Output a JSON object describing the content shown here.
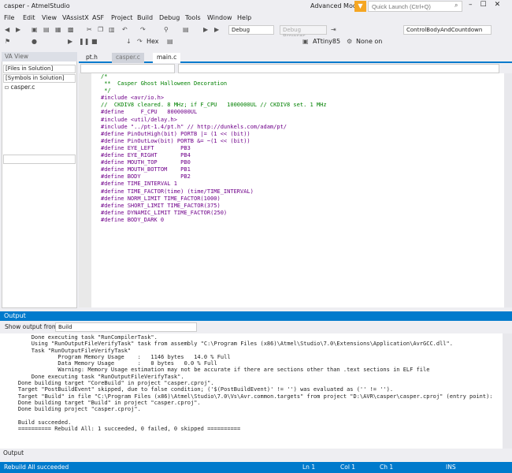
{
  "window": {
    "title": "casper - AtmelStudio",
    "mode": "Advanced Mode",
    "quick_launch": "Quick Launch (Ctrl+Q)"
  },
  "menu": [
    "File",
    "Edit",
    "View",
    "VAssistX",
    "ASF",
    "Project",
    "Build",
    "Debug",
    "Tools",
    "Window",
    "Help"
  ],
  "toolbar": {
    "config": "Debug",
    "platform": "Debug Browser",
    "target": "ControlBodyAndCountdown",
    "device": "ATtiny85",
    "tool": "None on",
    "hex": "Hex"
  },
  "va_view": {
    "title": "VA View",
    "filter1": "[Files in Solution]",
    "filter2": "[Symbols in Solution]",
    "item": "casper.c"
  },
  "tabs": [
    "pt.h",
    "casper.c",
    "main.c"
  ],
  "code": [
    {
      "t": "c",
      "v": "/*"
    },
    {
      "t": "c",
      "v": " **  Casper Ghost Halloween Decoration"
    },
    {
      "t": "c",
      "v": " */"
    },
    {
      "t": "n",
      "v": ""
    },
    {
      "t": "d",
      "v": "#include <avr/io.h>"
    },
    {
      "t": "c",
      "v": "//  CKDIV8 cleared. 8 MHz; if F_CPU   1000000UL // CKDIV8 set. 1 MHz"
    },
    {
      "t": "d",
      "v": "#define     F_CPU   8000000UL"
    },
    {
      "t": "d",
      "v": "#include <util/delay.h>"
    },
    {
      "t": "d",
      "v": "#include \"../pt-1.4/pt.h\" // http://dunkels.com/adam/pt/"
    },
    {
      "t": "n",
      "v": ""
    },
    {
      "t": "d",
      "v": "#define PinOutHigh(bit) PORTB |= (1 << (bit))"
    },
    {
      "t": "n",
      "v": ""
    },
    {
      "t": "d",
      "v": "#define PinOutLow(bit) PORTB &= ~(1 << (bit))"
    },
    {
      "t": "n",
      "v": ""
    },
    {
      "t": "d",
      "v": "#define EYE_LEFT        PB3"
    },
    {
      "t": "d",
      "v": "#define EYE_RIGHT       PB4"
    },
    {
      "t": "n",
      "v": ""
    },
    {
      "t": "d",
      "v": "#define MOUTH_TOP       PB0"
    },
    {
      "t": "d",
      "v": "#define MOUTH_BOTTOM    PB1"
    },
    {
      "t": "d",
      "v": "#define BODY            PB2"
    },
    {
      "t": "n",
      "v": ""
    },
    {
      "t": "d",
      "v": "#define TIME_INTERVAL 1"
    },
    {
      "t": "n",
      "v": ""
    },
    {
      "t": "d",
      "v": "#define TIME_FACTOR(time) (time/TIME_INTERVAL)"
    },
    {
      "t": "n",
      "v": ""
    },
    {
      "t": "d",
      "v": "#define NORM_LIMIT TIME_FACTOR(1000)"
    },
    {
      "t": "n",
      "v": ""
    },
    {
      "t": "d",
      "v": "#define SHORT_LIMIT TIME_FACTOR(375)"
    },
    {
      "t": "n",
      "v": ""
    },
    {
      "t": "d",
      "v": "#define DYNAMIC_LIMIT TIME_FACTOR(250)"
    },
    {
      "t": "n",
      "v": ""
    },
    {
      "t": "d",
      "v": "#define BODY_DARK 0"
    }
  ],
  "output": {
    "title": "Output",
    "show_from_label": "Show output from:",
    "source": "Build",
    "lines": [
      "        Done executing task \"RunCompilerTask\".",
      "        Using \"RunOutputFileVerifyTask\" task from assembly \"C:\\Program Files (x86)\\Atmel\\Studio\\7.0\\Extensions\\Application\\AvrGCC.dll\".",
      "        Task \"RunOutputFileVerifyTask\"",
      "                Program Memory Usage    :   1146 bytes   14.0 % Full",
      "                Data Memory Usage       :   0 bytes   0.0 % Full",
      "                Warning: Memory Usage estimation may not be accurate if there are sections other than .text sections in ELF file",
      "        Done executing task \"RunOutputFileVerifyTask\".",
      "    Done building target \"CoreBuild\" in project \"casper.cproj\".",
      "    Target \"PostBuildEvent\" skipped, due to false condition; ('$(PostBuildEvent)' != '') was evaluated as ('' != '').",
      "    Target \"Build\" in file \"C:\\Program Files (x86)\\Atmel\\Studio\\7.0\\Vs\\Avr.common.targets\" from project \"D:\\AVR\\casper\\casper.cproj\" (entry point):",
      "    Done building target \"Build\" in project \"casper.cproj\".",
      "    Done building project \"casper.cproj\".",
      "",
      "    Build succeeded.",
      "    ========== Rebuild All: 1 succeeded, 0 failed, 0 skipped =========="
    ],
    "tab": "Output"
  },
  "status": {
    "message": "Rebuild All succeeded",
    "ln": "Ln 1",
    "col": "Col 1",
    "ch": "Ch 1",
    "ins": "INS"
  }
}
